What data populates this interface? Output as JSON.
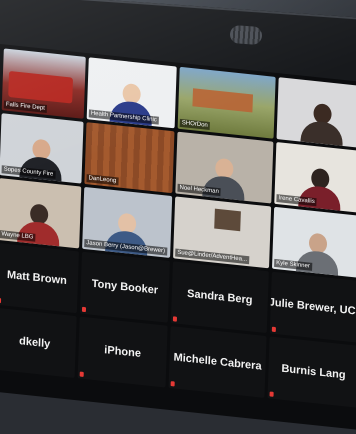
{
  "tiles": [
    {
      "label": "Falls Fire Dept",
      "scene": "fire-truck"
    },
    {
      "label": "Health Partnership Clinic",
      "scene": "speaker"
    },
    {
      "label": "SHOrDon",
      "scene": "campus"
    },
    {
      "label": "",
      "scene": "woman-dark-hair"
    },
    {
      "label": "Sopes County Fire",
      "scene": "man-glasses"
    },
    {
      "label": "DanLeong",
      "scene": "wood-panel"
    },
    {
      "label": "Noel Heckman",
      "scene": "office-man"
    },
    {
      "label": "Irene Cavallis",
      "scene": "woman-glasses"
    },
    {
      "label": "Wayne LBG",
      "scene": "woman-red"
    },
    {
      "label": "Jason Berry (Jason@Brewer)",
      "scene": "man-bald"
    },
    {
      "label": "Sue@Linder/AdventHea...",
      "scene": "office-wall"
    },
    {
      "label": "Kyle Skinner",
      "scene": "man-window"
    },
    {
      "name": "Matt Brown"
    },
    {
      "name": "Tony Booker"
    },
    {
      "name": "Sandra Berg"
    },
    {
      "name": "Julie Brewer, UCS"
    },
    {
      "name": "dkelly"
    },
    {
      "name": "iPhone"
    },
    {
      "name": "Michelle Cabrera"
    },
    {
      "name": "Burnis Lang"
    }
  ]
}
